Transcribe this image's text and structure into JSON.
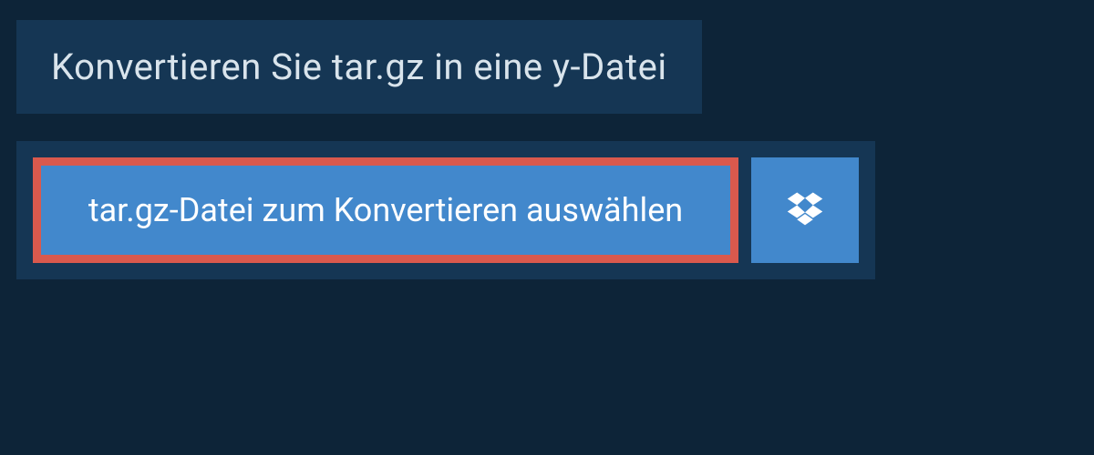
{
  "heading": {
    "title": "Konvertieren Sie tar.gz in eine y-Datei"
  },
  "upload": {
    "select_label": "tar.gz-Datei zum Konvertieren auswählen"
  }
}
